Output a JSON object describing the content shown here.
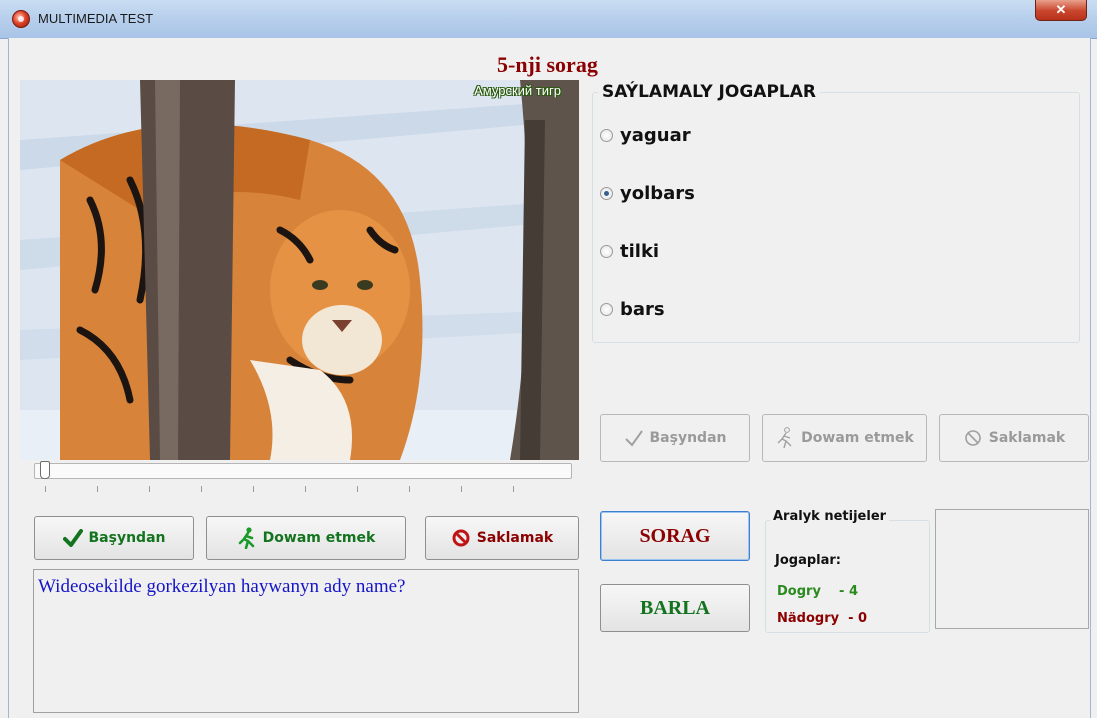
{
  "window": {
    "title": "MULTIMEDIA TEST",
    "close_glyph": "✕"
  },
  "question": {
    "header": "5-nji sorag",
    "text": "Wideosekilde gorkezilyan haywanyn ady name?"
  },
  "video": {
    "caption": "Амурский тигр",
    "seek_position": 0.0
  },
  "video_controls": {
    "restart_label": "Başyndan",
    "restart_icon": "checkmark-icon",
    "continue_label": "Dowam etmek",
    "continue_icon": "running-man-icon",
    "stop_label": "Saklamak",
    "stop_icon": "no-entry-icon"
  },
  "answers": {
    "title": "SAÝLAMALY JOGAPLAR",
    "options": [
      {
        "label": "yaguar",
        "checked": false
      },
      {
        "label": "yolbars",
        "checked": true
      },
      {
        "label": "tilki",
        "checked": false
      },
      {
        "label": "bars",
        "checked": false
      }
    ]
  },
  "secondary_controls": {
    "restart_label": "Başyndan",
    "continue_label": "Dowam etmek",
    "stop_label": "Saklamak",
    "enabled": false
  },
  "actions": {
    "sorag_label": "SORAG",
    "barla_label": "BARLA"
  },
  "results": {
    "title": "Aralyk netijeler",
    "answers_label": "Jogaplar:",
    "correct_line": "Dogry    - 4",
    "wrong_line": "Nädogry  - 0"
  },
  "colors": {
    "accent_red": "#8b0000",
    "accent_green": "#14731e",
    "question_blue": "#1515c8"
  }
}
